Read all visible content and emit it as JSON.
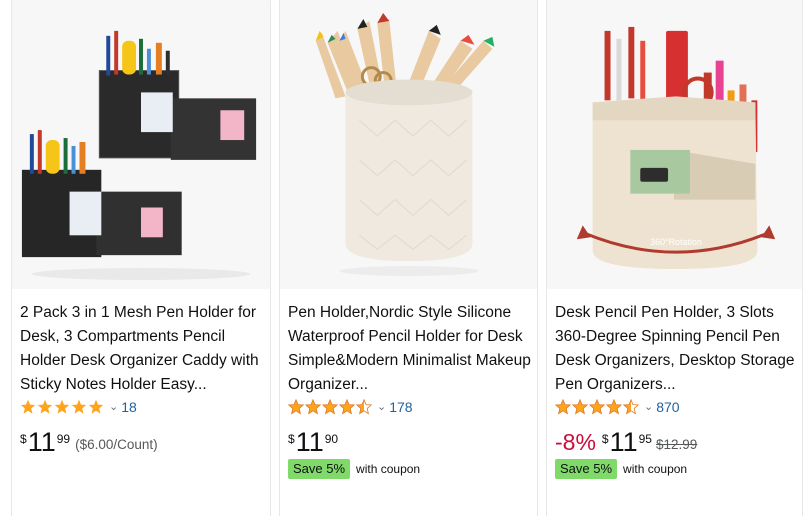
{
  "products": [
    {
      "title": "2 Pack 3 in 1 Mesh Pen Holder for Desk, 3 Compartments Pencil Holder Desk Organizer Caddy with Sticky Notes Holder Easy...",
      "rating": 5,
      "review_count": "18",
      "price": {
        "currency": "$",
        "whole": "11",
        "fraction": "99"
      },
      "unit_price": "($6.00/Count)",
      "image": "black mesh desk organizers with pens and sticky notes"
    },
    {
      "title": "Pen Holder,Nordic Style Silicone Waterproof Pencil Holder for Desk Simple&Modern Minimalist Makeup Organizer...",
      "rating": 4.5,
      "review_count": "178",
      "price": {
        "currency": "$",
        "whole": "11",
        "fraction": "90"
      },
      "coupon": {
        "badge": "Save 5%",
        "text": "with coupon"
      },
      "image": "white textured cup pencil holder with colored pencils"
    },
    {
      "title": "Desk Pencil Pen Holder, 3 Slots 360-Degree Spinning Pencil Pen Desk Organizers, Desktop Storage Pen Organizers...",
      "rating": 4.5,
      "review_count": "870",
      "discount": "-8%",
      "price": {
        "currency": "$",
        "whole": "11",
        "fraction": "95"
      },
      "list_price": "$12.99",
      "coupon": {
        "badge": "Save 5%",
        "text": "with coupon"
      },
      "image_label": "360°Rotation",
      "image": "beige rotating pen organizer with pens"
    }
  ],
  "colors": {
    "star": "#ffa41c",
    "link": "#2162a1",
    "deal": "#cc0c39",
    "coupon_badge": "#7fda69"
  },
  "icons": {
    "rating": "star-icon",
    "expand": "chevron-down-icon"
  }
}
